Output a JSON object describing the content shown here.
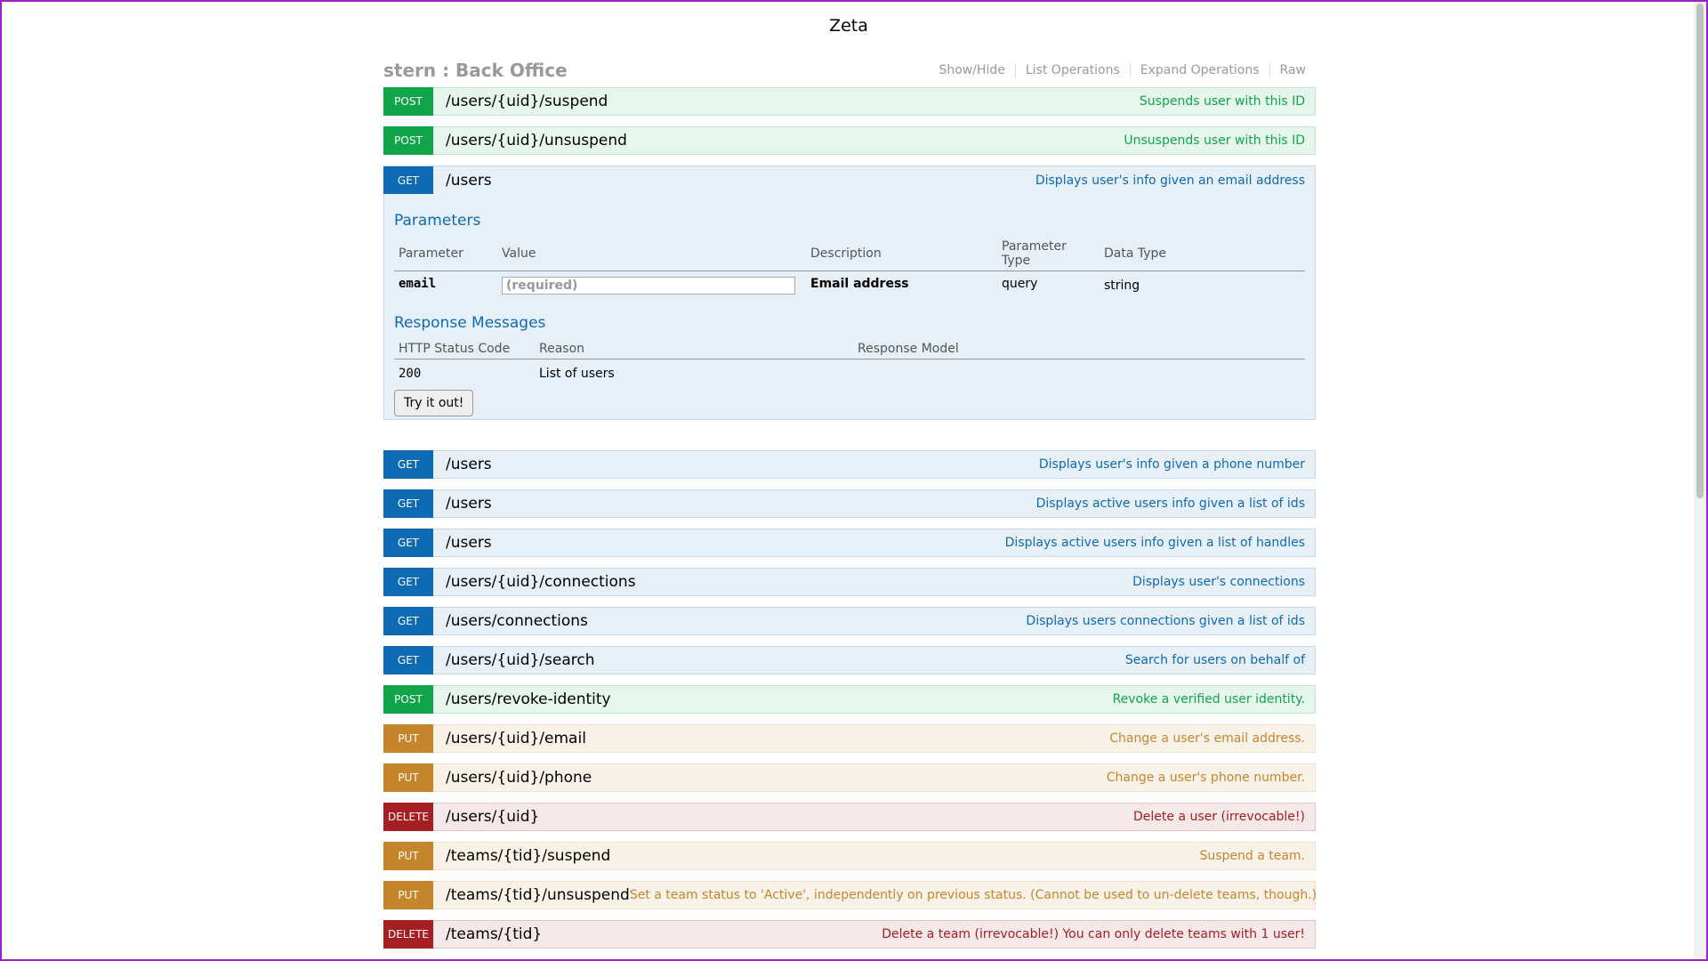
{
  "page_title": "Zeta",
  "resource": {
    "title": "stern : Back Office",
    "links": [
      "Show/Hide",
      "List Operations",
      "Expand Operations",
      "Raw"
    ]
  },
  "ops_top": [
    {
      "method": "POST",
      "path": "/users/{uid}/suspend",
      "summary": "Suspends user with this ID"
    },
    {
      "method": "POST",
      "path": "/users/{uid}/unsuspend",
      "summary": "Unsuspends user with this ID"
    }
  ],
  "expanded_op": {
    "method": "GET",
    "path": "/users",
    "summary": "Displays user's info given an email address",
    "parameters_title": "Parameters",
    "param_headers": [
      "Parameter",
      "Value",
      "Description",
      "Parameter Type",
      "Data Type"
    ],
    "param": {
      "name": "email",
      "placeholder": "(required)",
      "description": "Email address",
      "type": "query",
      "data_type": "string"
    },
    "responses_title": "Response Messages",
    "response_headers": [
      "HTTP Status Code",
      "Reason",
      "Response Model"
    ],
    "response": {
      "code": "200",
      "reason": "List of users",
      "model": ""
    },
    "try_label": "Try it out!"
  },
  "ops_bottom": [
    {
      "method": "GET",
      "path": "/users",
      "summary": "Displays user's info given a phone number"
    },
    {
      "method": "GET",
      "path": "/users",
      "summary": "Displays active users info given a list of ids"
    },
    {
      "method": "GET",
      "path": "/users",
      "summary": "Displays active users info given a list of handles"
    },
    {
      "method": "GET",
      "path": "/users/{uid}/connections",
      "summary": "Displays user's connections"
    },
    {
      "method": "GET",
      "path": "/users/connections",
      "summary": "Displays users connections given a list of ids"
    },
    {
      "method": "GET",
      "path": "/users/{uid}/search",
      "summary": "Search for users on behalf of"
    },
    {
      "method": "POST",
      "path": "/users/revoke-identity",
      "summary": "Revoke a verified user identity."
    },
    {
      "method": "PUT",
      "path": "/users/{uid}/email",
      "summary": "Change a user's email address."
    },
    {
      "method": "PUT",
      "path": "/users/{uid}/phone",
      "summary": "Change a user's phone number."
    },
    {
      "method": "DELETE",
      "path": "/users/{uid}",
      "summary": "Delete a user (irrevocable!)"
    },
    {
      "method": "PUT",
      "path": "/teams/{tid}/suspend",
      "summary": "Suspend a team."
    },
    {
      "method": "PUT",
      "path": "/teams/{tid}/unsuspend",
      "summary": "Set a team status to 'Active', independently on previous status. (Cannot be used to un-delete teams, though.)"
    },
    {
      "method": "DELETE",
      "path": "/teams/{tid}",
      "summary": "Delete a team (irrevocable!) You can only delete teams with 1 user!"
    }
  ],
  "colors": {
    "post": "#10a54a",
    "get": "#0f6ab4",
    "put": "#c5862b",
    "delete": "#a41e22"
  }
}
